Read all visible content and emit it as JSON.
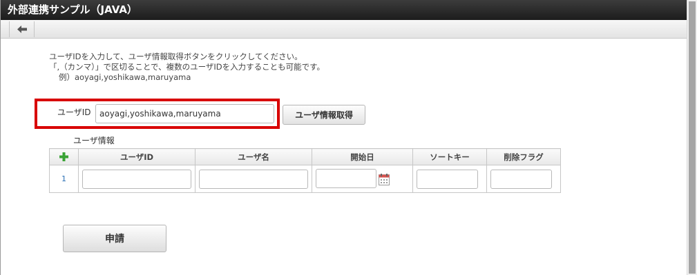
{
  "window": {
    "title": "外部連携サンプル（JAVA）"
  },
  "toolbar": {
    "back_icon": "arrow-left-icon"
  },
  "help": {
    "line1": "ユーザIDを入力して、ユーザ情報取得ボタンをクリックしてください。",
    "line2": "「,（カンマ）」で区切ることで、複数のユーザIDを入力することも可能です。",
    "line3": "例）aoyagi,yoshikawa,maruyama"
  },
  "user_id_field": {
    "label": "ユーザID",
    "value": "aoyagi,yoshikawa,maruyama"
  },
  "fetch_button": {
    "label": "ユーザ情報取得"
  },
  "user_info": {
    "section_label": "ユーザ情報",
    "columns": [
      "ユーザID",
      "ユーザ名",
      "開始日",
      "ソートキー",
      "削除フラグ"
    ],
    "rows": [
      {
        "num": "1"
      }
    ]
  },
  "apply_button": {
    "label": "申請"
  },
  "colors": {
    "highlight": "#d80000",
    "titlebar": "#2a2a2a",
    "add_icon": "#3aa335"
  }
}
